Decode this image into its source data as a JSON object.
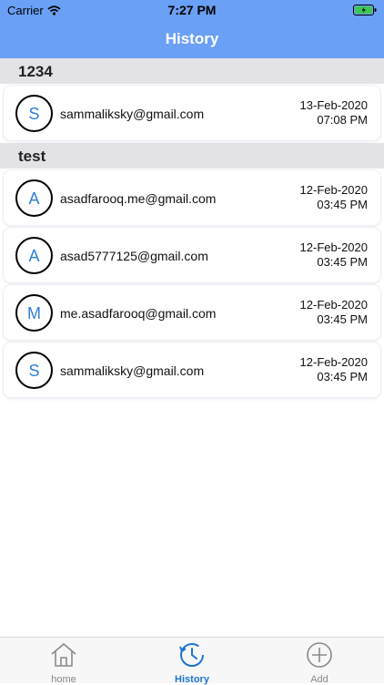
{
  "status_bar": {
    "carrier": "Carrier",
    "time": "7:27 PM"
  },
  "nav": {
    "title": "History"
  },
  "sections": [
    {
      "title": "1234",
      "items": [
        {
          "initial": "S",
          "email": "sammaliksky@gmail.com",
          "date": "13-Feb-2020",
          "time": "07:08 PM"
        }
      ]
    },
    {
      "title": "test",
      "items": [
        {
          "initial": "A",
          "email": "asadfarooq.me@gmail.com",
          "date": "12-Feb-2020",
          "time": "03:45 PM"
        },
        {
          "initial": "A",
          "email": "asad5777125@gmail.com",
          "date": "12-Feb-2020",
          "time": "03:45 PM"
        },
        {
          "initial": "M",
          "email": "me.asadfarooq@gmail.com",
          "date": "12-Feb-2020",
          "time": "03:45 PM"
        },
        {
          "initial": "S",
          "email": "sammaliksky@gmail.com",
          "date": "12-Feb-2020",
          "time": "03:45 PM"
        }
      ]
    }
  ],
  "tabs": [
    {
      "label": "home",
      "icon": "home-icon",
      "active": false
    },
    {
      "label": "History",
      "icon": "history-icon",
      "active": true
    },
    {
      "label": "Add",
      "icon": "add-icon",
      "active": false
    }
  ],
  "colors": {
    "header": "#6aa0f5",
    "accent": "#1f76d2",
    "avatar_letter": "#2f7fd6"
  }
}
